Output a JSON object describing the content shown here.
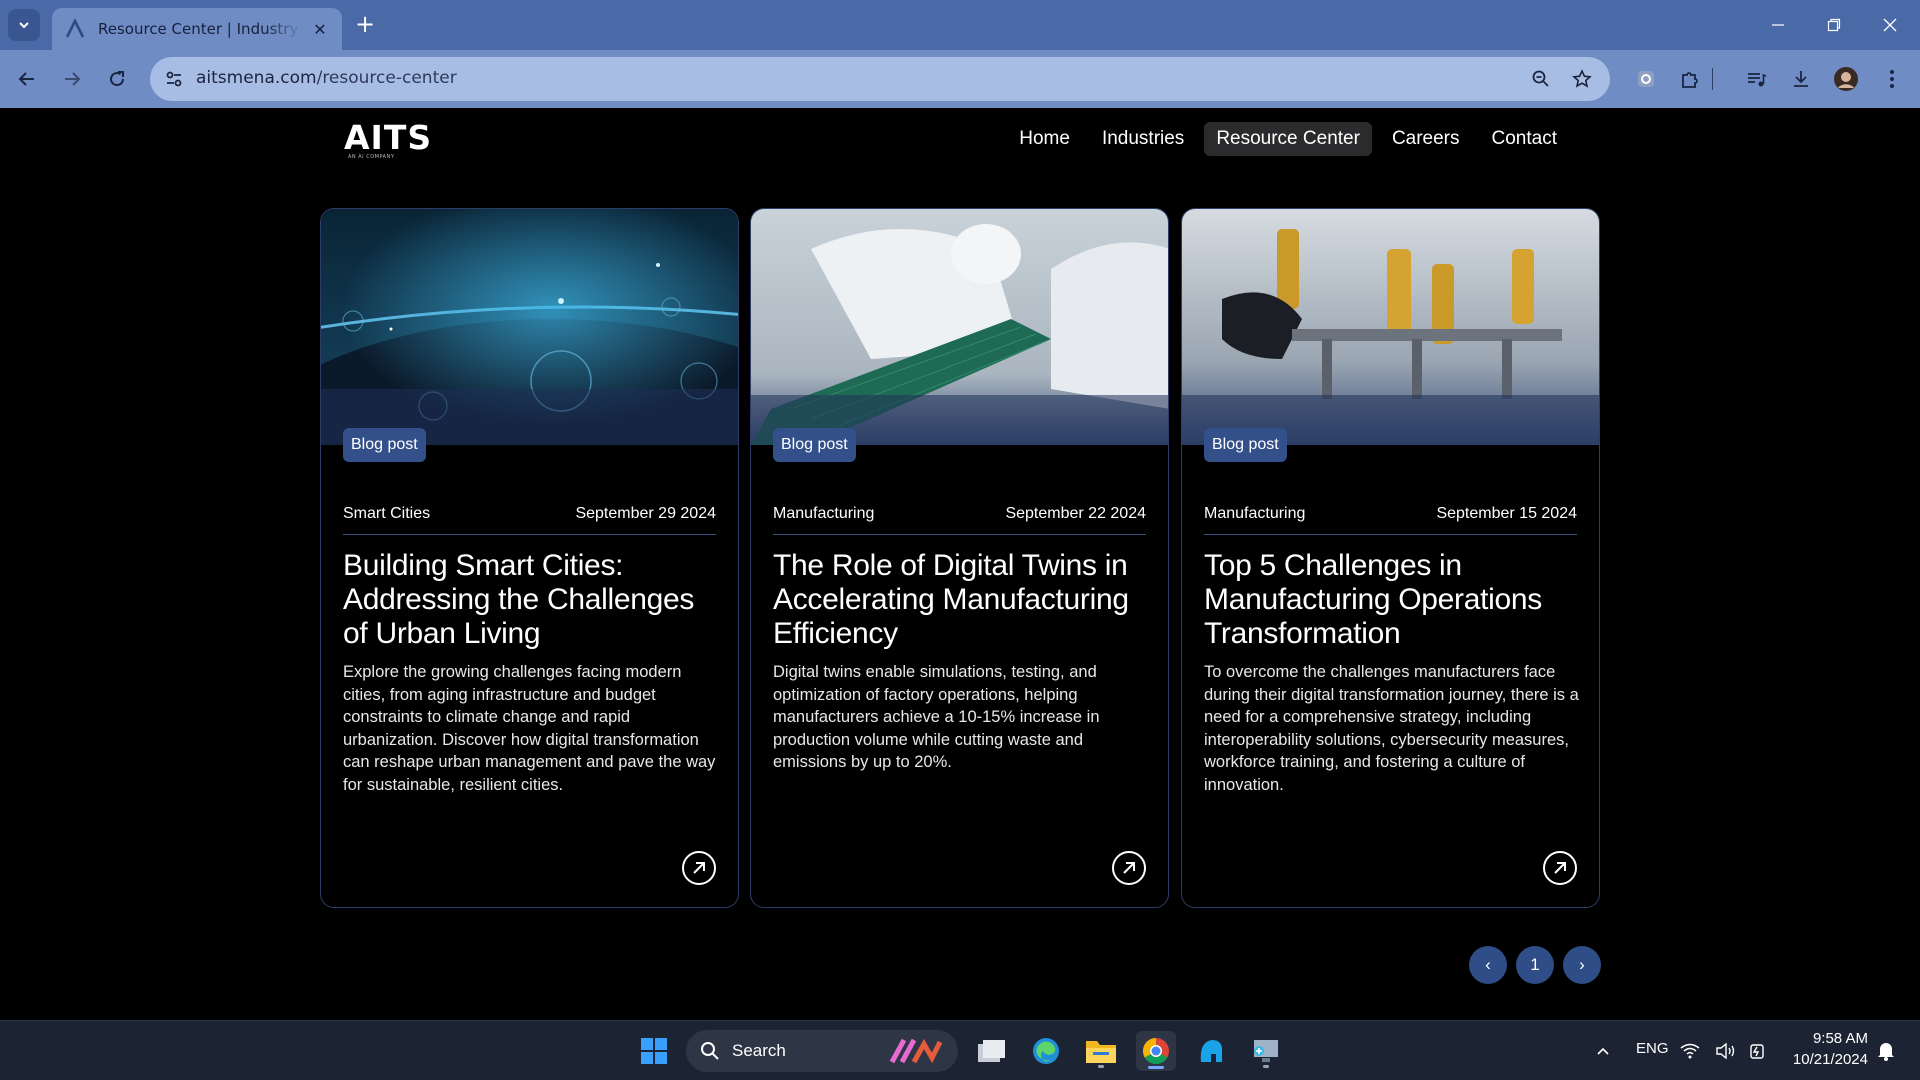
{
  "browser": {
    "tab_title": "Resource Center | Industry Insights",
    "url_host": "aitsmena.com",
    "url_path": "/resource-center"
  },
  "site": {
    "logo": "AITS",
    "logo_sub": "AN AI COMPANY",
    "nav": [
      {
        "label": "Home"
      },
      {
        "label": "Industries"
      },
      {
        "label": "Resource Center",
        "active": true
      },
      {
        "label": "Careers"
      },
      {
        "label": "Contact"
      }
    ]
  },
  "cards": [
    {
      "badge": "Blog post",
      "category": "Smart Cities",
      "date": "September 29 2024",
      "title": "Building Smart Cities: Addressing the Challenges of Urban Living",
      "description": "Explore the growing challenges facing modern cities, from aging infrastructure and budget constraints to climate change and rapid urbanization. Discover how digital transformation can reshape urban management and pave the way for sustainable, resilient cities."
    },
    {
      "badge": "Blog post",
      "category": "Manufacturing",
      "date": "September 22 2024",
      "title": "The Role of Digital Twins in Accelerating Manufacturing Efficiency",
      "description": "Digital twins enable simulations, testing, and optimization of factory operations, helping manufacturers achieve a 10-15% increase in production volume while cutting waste and emissions by up to 20%."
    },
    {
      "badge": "Blog post",
      "category": "Manufacturing",
      "date": "September 15 2024",
      "title": "Top 5 Challenges in Manufacturing Operations Transformation",
      "description": "To overcome the challenges manufacturers face during their digital transformation journey, there is a need for a comprehensive strategy, including interoperability solutions, cybersecurity measures, workforce training, and fostering a culture of innovation."
    }
  ],
  "pagination": {
    "prev": "‹",
    "current": "1",
    "next": "›"
  },
  "taskbar": {
    "search_label": "Search",
    "language": "ENG",
    "time": "9:58 AM",
    "date": "10/21/2024"
  },
  "colors": {
    "tabbar": "#4a6aa7",
    "toolbar": "#6f8cc4",
    "accent": "#2f4d86",
    "card_border": "#2d3d66"
  }
}
